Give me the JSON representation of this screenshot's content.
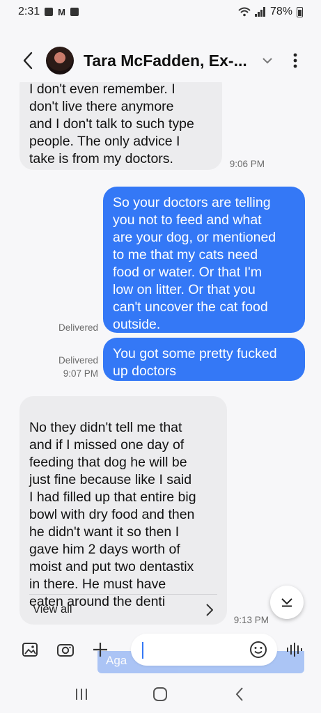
{
  "status_bar": {
    "time": "2:31",
    "battery": "78%",
    "icons": [
      "image-icon",
      "gmail-icon",
      "app-icon",
      "wifi-icon",
      "signal-icon",
      "battery-icon"
    ]
  },
  "header": {
    "contact_name": "Tara McFadden, Ex-...",
    "icons": [
      "back-arrow-icon",
      "avatar",
      "chevron-down-icon",
      "more-vert-icon"
    ]
  },
  "messages": [
    {
      "direction": "incoming",
      "text": "I don't even remember. I\ndon't live there anymore\nand I don't talk to such type\npeople. The only advice I\ntake is from my doctors.",
      "time": "9:06 PM"
    },
    {
      "direction": "outgoing",
      "text": "So your doctors are telling\nyou not to feed and what\nare your dog, or mentioned\nto me that my cats need\nfood or water. Or that I'm\nlow on litter. Or that you\ncan't uncover the cat food\noutside.",
      "status": "Delivered"
    },
    {
      "direction": "outgoing",
      "text": "You got some pretty fucked\nup doctors",
      "status": "Delivered",
      "time": "9:07 PM"
    },
    {
      "direction": "incoming",
      "text": "No they didn't tell me that\nand if I missed one day of\nfeeding that dog he will be\njust fine because like I said\nI had filled up that entire big\nbowl with dry food and then\nhe didn't want it so then I\ngave him 2 days worth of\nmoist and put two dentastix\nin  there. He must have\neaten around the denti",
      "view_all": "View all",
      "time": "9:13 PM"
    }
  ],
  "ghost_text": "Aga",
  "composer": {
    "placeholder": "",
    "icons": [
      "gallery-icon",
      "camera-icon",
      "plus-icon",
      "emoji-icon",
      "voice-icon"
    ]
  },
  "nav_bar": {
    "icons": [
      "recents-icon",
      "home-icon",
      "back-icon"
    ]
  },
  "colors": {
    "outgoing_bubble": "#3478f6",
    "incoming_bubble": "#ececee",
    "background": "#f7f7f9"
  }
}
